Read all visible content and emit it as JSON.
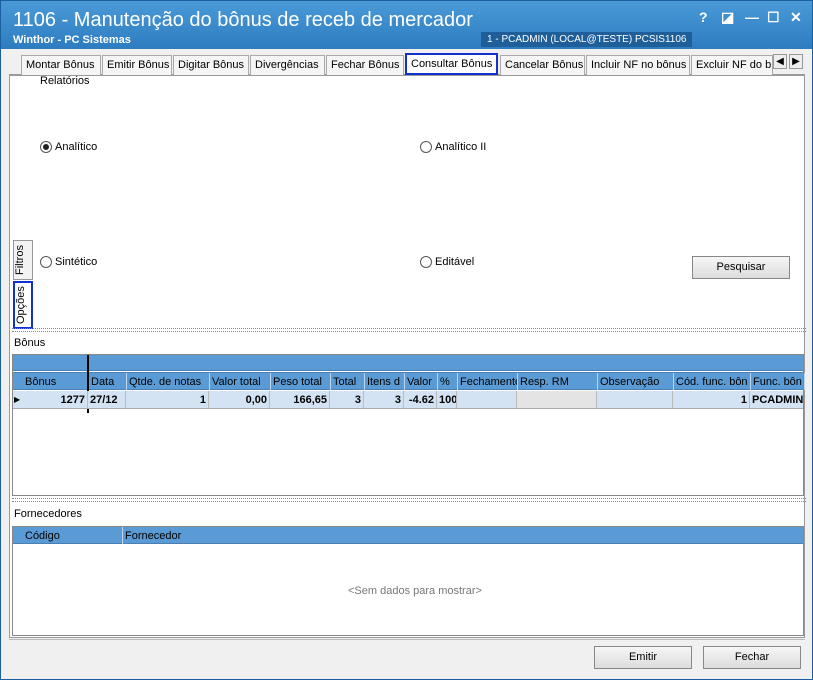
{
  "window": {
    "title": "1106 - Manutenção do bônus de receb de mercador",
    "subtitle": "Winthor - PC Sistemas",
    "session": "1 - PCADMIN (LOCAL@TESTE)   PCSIS1106",
    "help": "?",
    "restore": "◪",
    "minimize": "—",
    "maximize": "☐",
    "close": "✕"
  },
  "tabs": [
    "Montar Bônus",
    "Emitir Bônus",
    "Digitar Bônus",
    "Divergências",
    "Fechar Bônus",
    "Consultar Bônus",
    "Cancelar Bônus",
    "Incluir NF no bônus",
    "Excluir NF do b"
  ],
  "tab_nav": {
    "left": "◀",
    "right": "▶"
  },
  "side_tabs": {
    "filtros": "Filtros",
    "opcoes": "Opções"
  },
  "relatorios": {
    "label": "Relatórios",
    "analitico": "Analítico",
    "analitico2": "Analítico II",
    "sintetico": "Sintético",
    "editavel": "Editável",
    "selected": "Analítico"
  },
  "pesquisar": "Pesquisar",
  "bonus": {
    "label": "Bônus",
    "columns": [
      "Bônus",
      "Data",
      "Qtde. de notas",
      "Valor total",
      "Peso total",
      "Total",
      "Itens d",
      "Valor",
      "%",
      "Fechamento",
      "Resp. RM",
      "Observação",
      "Cód. func. bôn",
      "Func. bôn"
    ],
    "row": [
      "1277",
      "27/12",
      "1",
      "0,00",
      "166,65",
      "3",
      "3",
      "-4.62",
      "100",
      "",
      "",
      "",
      "1",
      "PCADMIN"
    ]
  },
  "fornecedores": {
    "label": "Fornecedores",
    "columns": [
      "Código",
      "Fornecedor"
    ],
    "empty": "<Sem dados para mostrar>"
  },
  "footer": {
    "emitir": "Emitir",
    "fechar": "Fechar"
  },
  "colors": {
    "titlebar": "#2d7cc0",
    "grid_header": "#5b9bd5",
    "highlight": "#1030d0"
  }
}
